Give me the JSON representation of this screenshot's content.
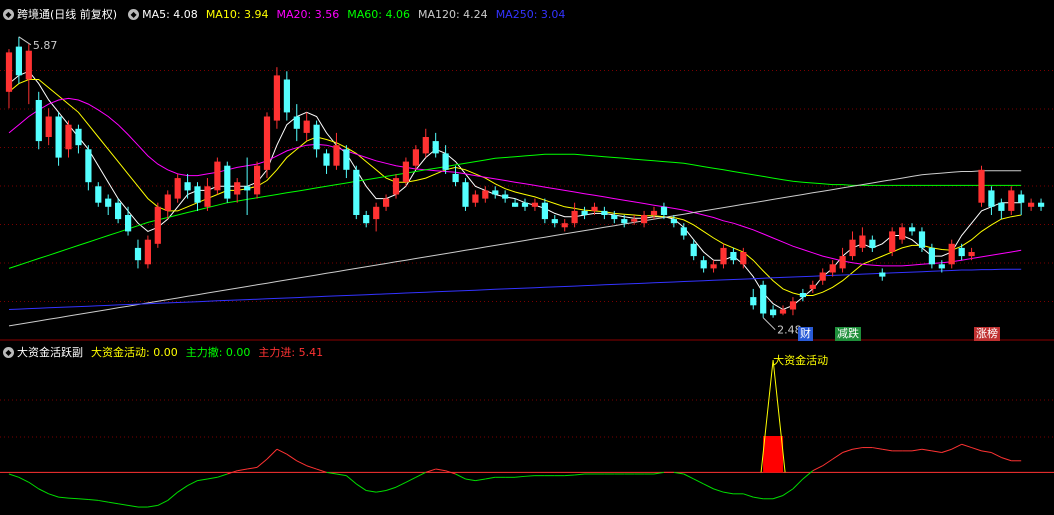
{
  "main_panel": {
    "title": "跨境通",
    "mode": "(日线 前复权)",
    "indicators": [
      {
        "label": "MA5: 4.08",
        "color": "#ffffff"
      },
      {
        "label": "MA10: 3.94",
        "color": "#ffff00"
      },
      {
        "label": "MA20: 3.56",
        "color": "#ff00ff"
      },
      {
        "label": "MA60: 4.06",
        "color": "#00ff00"
      },
      {
        "label": "MA120: 4.24",
        "color": "#cccccc"
      },
      {
        "label": "MA250: 3.04",
        "color": "#3333ff"
      }
    ],
    "high_label": "5.87",
    "low_label": "2.48",
    "event_tags": [
      {
        "text": "财",
        "bg": "#2a5bd7"
      },
      {
        "text": "减跌",
        "bg": "#1e8f3a"
      },
      {
        "text": "涨榜",
        "bg": "#c03030"
      }
    ]
  },
  "sub_panel": {
    "title": "大资金活跃副",
    "indicators": [
      {
        "label": "大资金活动: 0.00",
        "color": "#ffff00"
      },
      {
        "label": "主力撤: 0.00",
        "color": "#00ff00"
      },
      {
        "label": "主力进: 5.41",
        "color": "#ff3333"
      }
    ],
    "annotation": "大资金活动"
  },
  "chart_data": {
    "type": "candlestick",
    "y_range": [
      2.3,
      6.05
    ],
    "candles": [
      [
        5.2,
        5.68,
        5.72,
        5.0
      ],
      [
        5.75,
        5.4,
        5.87,
        5.3
      ],
      [
        5.35,
        5.7,
        5.78,
        5.05
      ],
      [
        5.1,
        4.6,
        5.2,
        4.5
      ],
      [
        4.65,
        4.9,
        5.0,
        4.55
      ],
      [
        4.9,
        4.4,
        4.95,
        4.3
      ],
      [
        4.5,
        4.8,
        4.85,
        4.4
      ],
      [
        4.75,
        4.55,
        4.8,
        4.45
      ],
      [
        4.5,
        4.1,
        4.55,
        4.0
      ],
      [
        4.05,
        3.85,
        4.1,
        3.8
      ],
      [
        3.9,
        3.8,
        3.95,
        3.7
      ],
      [
        3.85,
        3.65,
        3.9,
        3.6
      ],
      [
        3.7,
        3.5,
        3.8,
        3.45
      ],
      [
        3.3,
        3.15,
        3.4,
        3.05
      ],
      [
        3.1,
        3.4,
        3.45,
        3.05
      ],
      [
        3.35,
        3.8,
        3.85,
        3.3
      ],
      [
        3.75,
        3.95,
        4.0,
        3.65
      ],
      [
        3.9,
        4.15,
        4.2,
        3.85
      ],
      [
        4.1,
        4.0,
        4.2,
        3.9
      ],
      [
        4.05,
        3.85,
        4.1,
        3.75
      ],
      [
        3.8,
        4.05,
        4.15,
        3.75
      ],
      [
        4.0,
        4.35,
        4.4,
        3.95
      ],
      [
        4.3,
        3.9,
        4.35,
        3.85
      ],
      [
        3.95,
        4.1,
        4.15,
        3.85
      ],
      [
        4.05,
        4.0,
        4.4,
        3.7
      ],
      [
        3.95,
        4.3,
        4.35,
        3.9
      ],
      [
        4.25,
        4.9,
        4.95,
        4.15
      ],
      [
        4.85,
        5.4,
        5.5,
        4.75
      ],
      [
        5.35,
        4.95,
        5.45,
        4.85
      ],
      [
        4.9,
        4.75,
        5.05,
        4.6
      ],
      [
        4.7,
        4.85,
        4.95,
        4.6
      ],
      [
        4.8,
        4.5,
        4.85,
        4.4
      ],
      [
        4.45,
        4.3,
        4.5,
        4.2
      ],
      [
        4.3,
        4.55,
        4.7,
        4.25
      ],
      [
        4.5,
        4.25,
        4.55,
        4.15
      ],
      [
        4.25,
        3.7,
        4.3,
        3.65
      ],
      [
        3.7,
        3.6,
        3.75,
        3.55
      ],
      [
        3.65,
        3.8,
        3.85,
        3.5
      ],
      [
        3.8,
        3.9,
        3.95,
        3.75
      ],
      [
        3.95,
        4.15,
        4.2,
        3.9
      ],
      [
        4.1,
        4.35,
        4.4,
        4.05
      ],
      [
        4.3,
        4.5,
        4.55,
        4.25
      ],
      [
        4.45,
        4.65,
        4.75,
        4.4
      ],
      [
        4.6,
        4.45,
        4.7,
        4.4
      ],
      [
        4.45,
        4.25,
        4.55,
        4.2
      ],
      [
        4.2,
        4.1,
        4.3,
        4.05
      ],
      [
        4.1,
        3.8,
        4.15,
        3.75
      ],
      [
        3.85,
        3.95,
        4.0,
        3.8
      ],
      [
        3.9,
        4.0,
        4.05,
        3.85
      ],
      [
        4.0,
        3.95,
        4.05,
        3.9
      ],
      [
        3.95,
        3.9,
        4.0,
        3.85
      ],
      [
        3.85,
        3.8,
        3.9,
        3.8
      ],
      [
        3.85,
        3.8,
        3.9,
        3.75
      ],
      [
        3.8,
        3.85,
        3.9,
        3.75
      ],
      [
        3.85,
        3.65,
        3.9,
        3.6
      ],
      [
        3.65,
        3.6,
        3.7,
        3.55
      ],
      [
        3.55,
        3.6,
        3.65,
        3.5
      ],
      [
        3.6,
        3.75,
        3.85,
        3.55
      ],
      [
        3.75,
        3.7,
        3.8,
        3.65
      ],
      [
        3.75,
        3.8,
        3.85,
        3.7
      ],
      [
        3.75,
        3.7,
        3.8,
        3.65
      ],
      [
        3.7,
        3.65,
        3.75,
        3.6
      ],
      [
        3.65,
        3.6,
        3.7,
        3.55
      ],
      [
        3.62,
        3.65,
        3.7,
        3.58
      ],
      [
        3.6,
        3.7,
        3.75,
        3.55
      ],
      [
        3.7,
        3.75,
        3.8,
        3.65
      ],
      [
        3.8,
        3.7,
        3.85,
        3.65
      ],
      [
        3.65,
        3.6,
        3.7,
        3.55
      ],
      [
        3.55,
        3.45,
        3.6,
        3.4
      ],
      [
        3.35,
        3.2,
        3.4,
        3.15
      ],
      [
        3.15,
        3.05,
        3.2,
        3.0
      ],
      [
        3.05,
        3.1,
        3.15,
        3.0
      ],
      [
        3.1,
        3.3,
        3.35,
        3.05
      ],
      [
        3.25,
        3.15,
        3.3,
        3.1
      ],
      [
        3.1,
        3.25,
        3.3,
        3.05
      ],
      [
        2.7,
        2.6,
        2.8,
        2.55
      ],
      [
        2.85,
        2.5,
        2.9,
        2.45
      ],
      [
        2.55,
        2.48,
        2.6,
        2.45
      ],
      [
        2.5,
        2.55,
        2.6,
        2.48
      ],
      [
        2.55,
        2.65,
        2.7,
        2.48
      ],
      [
        2.75,
        2.7,
        2.8,
        2.65
      ],
      [
        2.8,
        2.85,
        2.9,
        2.75
      ],
      [
        2.9,
        3.0,
        3.05,
        2.85
      ],
      [
        3.0,
        3.1,
        3.15,
        2.95
      ],
      [
        3.05,
        3.2,
        3.3,
        3.0
      ],
      [
        3.2,
        3.4,
        3.5,
        3.15
      ],
      [
        3.3,
        3.45,
        3.55,
        3.25
      ],
      [
        3.4,
        3.3,
        3.45,
        3.25
      ],
      [
        3.0,
        2.95,
        3.05,
        2.9
      ],
      [
        3.25,
        3.5,
        3.55,
        3.2
      ],
      [
        3.4,
        3.55,
        3.6,
        3.35
      ],
      [
        3.55,
        3.5,
        3.6,
        3.45
      ],
      [
        3.5,
        3.3,
        3.55,
        3.25
      ],
      [
        3.3,
        3.1,
        3.35,
        3.05
      ],
      [
        3.1,
        3.05,
        3.15,
        3.0
      ],
      [
        3.1,
        3.35,
        3.4,
        3.05
      ],
      [
        3.3,
        3.2,
        3.35,
        3.15
      ],
      [
        3.2,
        3.25,
        3.3,
        3.15
      ],
      [
        3.85,
        4.25,
        4.3,
        3.8
      ],
      [
        4.0,
        3.8,
        4.05,
        3.7
      ],
      [
        3.85,
        3.75,
        3.9,
        3.65
      ],
      [
        3.75,
        4.0,
        4.05,
        3.7
      ],
      [
        3.95,
        3.85,
        4.0,
        3.7
      ],
      [
        3.8,
        3.85,
        3.9,
        3.75
      ],
      [
        3.85,
        3.8,
        3.9,
        3.75
      ]
    ],
    "ma5": [
      5.3,
      5.4,
      5.45,
      5.3,
      5.1,
      4.95,
      4.8,
      4.65,
      4.5,
      4.3,
      4.1,
      3.9,
      3.75,
      3.6,
      3.5,
      3.55,
      3.65,
      3.8,
      3.95,
      4.0,
      4.0,
      4.05,
      4.05,
      4.05,
      4.05,
      4.1,
      4.25,
      4.55,
      4.8,
      4.9,
      4.95,
      4.9,
      4.7,
      4.55,
      4.45,
      4.25,
      4.05,
      3.9,
      3.9,
      3.95,
      4.05,
      4.25,
      4.4,
      4.5,
      4.45,
      4.35,
      4.2,
      4.05,
      4.0,
      3.95,
      3.92,
      3.9,
      3.85,
      3.82,
      3.78,
      3.72,
      3.68,
      3.68,
      3.7,
      3.72,
      3.72,
      3.7,
      3.68,
      3.66,
      3.66,
      3.68,
      3.68,
      3.65,
      3.55,
      3.4,
      3.25,
      3.15,
      3.15,
      3.2,
      3.1,
      2.95,
      2.75,
      2.62,
      2.55,
      2.6,
      2.7,
      2.8,
      2.95,
      3.05,
      3.2,
      3.3,
      3.35,
      3.3,
      3.35,
      3.45,
      3.45,
      3.4,
      3.3,
      3.2,
      3.2,
      3.25,
      3.45,
      3.6,
      3.75,
      3.8,
      3.85,
      3.85,
      3.85
    ],
    "ma10": [
      5.2,
      5.3,
      5.35,
      5.35,
      5.25,
      5.15,
      5.05,
      4.95,
      4.8,
      4.65,
      4.5,
      4.35,
      4.2,
      4.05,
      3.9,
      3.8,
      3.75,
      3.75,
      3.8,
      3.85,
      3.9,
      3.95,
      4.0,
      4.0,
      4.02,
      4.05,
      4.12,
      4.25,
      4.4,
      4.5,
      4.6,
      4.65,
      4.62,
      4.58,
      4.52,
      4.45,
      4.35,
      4.25,
      4.15,
      4.1,
      4.1,
      4.12,
      4.15,
      4.2,
      4.25,
      4.28,
      4.25,
      4.2,
      4.15,
      4.08,
      4.02,
      3.98,
      3.95,
      3.92,
      3.88,
      3.84,
      3.8,
      3.78,
      3.76,
      3.75,
      3.74,
      3.72,
      3.71,
      3.7,
      3.69,
      3.69,
      3.68,
      3.67,
      3.64,
      3.58,
      3.5,
      3.42,
      3.35,
      3.3,
      3.25,
      3.15,
      3.02,
      2.9,
      2.8,
      2.75,
      2.72,
      2.72,
      2.76,
      2.82,
      2.9,
      3.0,
      3.1,
      3.15,
      3.2,
      3.25,
      3.3,
      3.33,
      3.33,
      3.3,
      3.28,
      3.27,
      3.32,
      3.4,
      3.5,
      3.58,
      3.65,
      3.68,
      3.7
    ],
    "ma20": [
      4.7,
      4.8,
      4.9,
      4.98,
      5.05,
      5.1,
      5.12,
      5.1,
      5.05,
      4.98,
      4.9,
      4.8,
      4.68,
      4.55,
      4.42,
      4.32,
      4.25,
      4.2,
      4.18,
      4.18,
      4.2,
      4.22,
      4.25,
      4.28,
      4.3,
      4.32,
      4.36,
      4.42,
      4.48,
      4.52,
      4.55,
      4.56,
      4.55,
      4.52,
      4.48,
      4.44,
      4.4,
      4.36,
      4.33,
      4.3,
      4.28,
      4.26,
      4.25,
      4.24,
      4.23,
      4.22,
      4.2,
      4.18,
      4.16,
      4.14,
      4.12,
      4.1,
      4.08,
      4.06,
      4.04,
      4.02,
      4.0,
      3.98,
      3.96,
      3.94,
      3.92,
      3.9,
      3.88,
      3.86,
      3.84,
      3.82,
      3.8,
      3.78,
      3.76,
      3.73,
      3.7,
      3.67,
      3.63,
      3.6,
      3.56,
      3.52,
      3.47,
      3.42,
      3.37,
      3.32,
      3.28,
      3.24,
      3.2,
      3.17,
      3.14,
      3.12,
      3.1,
      3.09,
      3.08,
      3.08,
      3.08,
      3.09,
      3.1,
      3.11,
      3.12,
      3.13,
      3.15,
      3.17,
      3.19,
      3.21,
      3.23,
      3.25,
      3.27
    ],
    "ma60": [
      3.05,
      3.09,
      3.13,
      3.17,
      3.21,
      3.25,
      3.29,
      3.33,
      3.37,
      3.41,
      3.45,
      3.49,
      3.53,
      3.57,
      3.61,
      3.64,
      3.67,
      3.7,
      3.73,
      3.76,
      3.79,
      3.82,
      3.85,
      3.87,
      3.89,
      3.91,
      3.93,
      3.95,
      3.97,
      3.99,
      4.01,
      4.03,
      4.05,
      4.07,
      4.09,
      4.11,
      4.13,
      4.15,
      4.17,
      4.19,
      4.21,
      4.23,
      4.25,
      4.27,
      4.29,
      4.31,
      4.33,
      4.35,
      4.37,
      4.39,
      4.4,
      4.41,
      4.42,
      4.43,
      4.44,
      4.44,
      4.44,
      4.44,
      4.43,
      4.42,
      4.41,
      4.4,
      4.39,
      4.38,
      4.37,
      4.36,
      4.35,
      4.34,
      4.33,
      4.31,
      4.29,
      4.27,
      4.25,
      4.23,
      4.21,
      4.19,
      4.17,
      4.15,
      4.13,
      4.11,
      4.1,
      4.09,
      4.08,
      4.07,
      4.07,
      4.06,
      4.06,
      4.06,
      4.06,
      4.06,
      4.06,
      4.06,
      4.06,
      4.06,
      4.06,
      4.06,
      4.06,
      4.06,
      4.06,
      4.06,
      4.06,
      4.06,
      4.06
    ],
    "ma120": [
      2.35,
      2.37,
      2.39,
      2.41,
      2.43,
      2.45,
      2.47,
      2.49,
      2.51,
      2.53,
      2.55,
      2.57,
      2.59,
      2.61,
      2.63,
      2.65,
      2.67,
      2.69,
      2.71,
      2.73,
      2.75,
      2.77,
      2.79,
      2.81,
      2.83,
      2.85,
      2.87,
      2.89,
      2.91,
      2.93,
      2.95,
      2.97,
      2.99,
      3.01,
      3.03,
      3.05,
      3.07,
      3.09,
      3.11,
      3.13,
      3.15,
      3.17,
      3.19,
      3.21,
      3.23,
      3.25,
      3.27,
      3.29,
      3.31,
      3.33,
      3.35,
      3.37,
      3.39,
      3.41,
      3.43,
      3.45,
      3.47,
      3.49,
      3.51,
      3.53,
      3.55,
      3.57,
      3.59,
      3.61,
      3.63,
      3.65,
      3.67,
      3.69,
      3.71,
      3.73,
      3.75,
      3.77,
      3.79,
      3.81,
      3.83,
      3.85,
      3.87,
      3.89,
      3.91,
      3.93,
      3.95,
      3.97,
      3.99,
      4.01,
      4.03,
      4.05,
      4.07,
      4.09,
      4.11,
      4.13,
      4.15,
      4.17,
      4.19,
      4.2,
      4.21,
      4.22,
      4.23,
      4.23,
      4.24,
      4.24,
      4.24,
      4.24,
      4.24
    ],
    "ma250": [
      2.55,
      2.555,
      2.56,
      2.565,
      2.57,
      2.575,
      2.58,
      2.585,
      2.59,
      2.595,
      2.6,
      2.605,
      2.61,
      2.615,
      2.62,
      2.625,
      2.63,
      2.635,
      2.64,
      2.645,
      2.65,
      2.655,
      2.66,
      2.665,
      2.67,
      2.675,
      2.68,
      2.685,
      2.69,
      2.695,
      2.7,
      2.705,
      2.71,
      2.715,
      2.72,
      2.725,
      2.73,
      2.735,
      2.74,
      2.745,
      2.75,
      2.755,
      2.76,
      2.765,
      2.77,
      2.775,
      2.78,
      2.785,
      2.79,
      2.795,
      2.8,
      2.805,
      2.81,
      2.815,
      2.82,
      2.825,
      2.83,
      2.835,
      2.84,
      2.845,
      2.85,
      2.855,
      2.86,
      2.865,
      2.87,
      2.875,
      2.88,
      2.885,
      2.89,
      2.895,
      2.9,
      2.905,
      2.91,
      2.915,
      2.92,
      2.925,
      2.93,
      2.935,
      2.94,
      2.945,
      2.95,
      2.955,
      2.96,
      2.965,
      2.97,
      2.975,
      2.98,
      2.985,
      2.99,
      2.995,
      3.0,
      3.005,
      3.01,
      3.015,
      3.02,
      3.025,
      3.03,
      3.03,
      3.035,
      3.035,
      3.04,
      3.04,
      3.04
    ],
    "sub_range": [
      -1.2,
      3.4
    ],
    "sub_line": [
      -0.05,
      -0.15,
      -0.3,
      -0.5,
      -0.65,
      -0.75,
      -0.78,
      -0.8,
      -0.82,
      -0.85,
      -0.9,
      -0.95,
      -1.0,
      -1.05,
      -1.05,
      -1.0,
      -0.85,
      -0.6,
      -0.4,
      -0.25,
      -0.2,
      -0.15,
      -0.05,
      0.05,
      0.1,
      0.15,
      0.4,
      0.7,
      0.55,
      0.35,
      0.2,
      0.1,
      0.0,
      -0.05,
      -0.1,
      -0.35,
      -0.55,
      -0.6,
      -0.55,
      -0.45,
      -0.3,
      -0.15,
      0.0,
      0.1,
      0.05,
      -0.05,
      -0.2,
      -0.25,
      -0.2,
      -0.15,
      -0.15,
      -0.15,
      -0.12,
      -0.1,
      -0.1,
      -0.1,
      -0.1,
      -0.08,
      -0.05,
      -0.05,
      -0.05,
      -0.05,
      -0.05,
      -0.05,
      -0.05,
      -0.05,
      0.0,
      0.0,
      -0.05,
      -0.2,
      -0.35,
      -0.5,
      -0.6,
      -0.65,
      -0.65,
      -0.75,
      -0.8,
      -0.8,
      -0.7,
      -0.5,
      -0.2,
      0.05,
      0.2,
      0.4,
      0.6,
      0.7,
      0.75,
      0.75,
      0.7,
      0.65,
      0.65,
      0.65,
      0.7,
      0.65,
      0.6,
      0.7,
      0.85,
      0.75,
      0.65,
      0.6,
      0.45,
      0.35,
      0.35
    ],
    "signal_index": 77,
    "signal_peak": 3.4,
    "signal_bar": 1.1,
    "candle_colors": {
      "up": "#ff3232",
      "down": "#54ffff"
    }
  }
}
